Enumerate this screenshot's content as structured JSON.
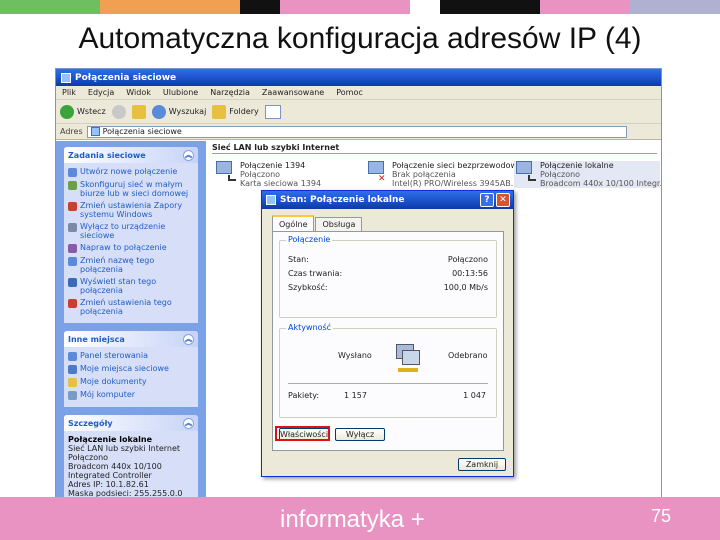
{
  "slide": {
    "title": "Automatyczna konfiguracja adresów IP (4)",
    "brand": "informatyka +",
    "page_number": "75",
    "colors": {
      "strip": [
        "#6fbf60",
        "#f0a050",
        "#111111",
        "#e893c2",
        "#f07a40",
        "#111111",
        "#e893c2",
        "#b0b0d0"
      ],
      "footer": "#e893c2"
    }
  },
  "window": {
    "title": "Połączenia sieciowe",
    "menu": [
      "Plik",
      "Edycja",
      "Widok",
      "Ulubione",
      "Narzędzia",
      "Zaawansowane",
      "Pomoc"
    ],
    "toolbar": {
      "back": "Wstecz",
      "search": "Wyszukaj",
      "folders": "Foldery"
    },
    "address_label": "Adres",
    "address_value": "Połączenia sieciowe"
  },
  "left_pane": {
    "network_tasks": {
      "title": "Zadania sieciowe",
      "items": [
        "Utwórz nowe połączenie",
        "Skonfiguruj sieć w małym biurze lub w sieci domowej",
        "Zmień ustawienia Zapory systemu Windows",
        "Wyłącz to urządzenie sieciowe",
        "Napraw to połączenie",
        "Zmień nazwę tego połączenia",
        "Wyświetl stan tego połączenia",
        "Zmień ustawienia tego połączenia"
      ]
    },
    "other_places": {
      "title": "Inne miejsca",
      "items": [
        "Panel sterowania",
        "Moje miejsca sieciowe",
        "Moje dokumenty",
        "Mój komputer"
      ]
    },
    "details": {
      "title": "Szczegóły",
      "name": "Połączenie lokalne",
      "lines": [
        "Sieć LAN lub szybki Internet",
        "Połączono",
        "Broadcom 440x 10/100 Integrated Controller",
        "Adres IP: 10.1.82.61",
        "Maska podsieci: 255.255.0.0"
      ]
    }
  },
  "group_header": "Sieć LAN lub szybki Internet",
  "connections": [
    {
      "name": "Połączenie 1394",
      "status": "Połączono",
      "device": "Karta sieciowa 1394"
    },
    {
      "name": "Połączenie sieci bezprzewodowej",
      "status": "Brak połączenia",
      "device": "Intel(R) PRO/Wireless 3945AB..."
    },
    {
      "name": "Połączenie lokalne",
      "status": "Połączono",
      "device": "Broadcom 440x 10/100 Integr..."
    }
  ],
  "dialog": {
    "title": "Stan: Połączenie lokalne",
    "tabs": [
      "Ogólne",
      "Obsługa"
    ],
    "connection_legend": "Połączenie",
    "rows": [
      {
        "label": "Stan:",
        "value": "Połączono"
      },
      {
        "label": "Czas trwania:",
        "value": "00:13:56"
      },
      {
        "label": "Szybkość:",
        "value": "100,0 Mb/s"
      }
    ],
    "activity_legend": "Aktywność",
    "sent_label": "Wysłano",
    "received_label": "Odebrano",
    "packets_label": "Pakiety:",
    "packets_sent": "1 157",
    "packets_received": "1 047",
    "properties_button": "Właściwości",
    "disable_button": "Wyłącz",
    "close_button": "Zamknij"
  }
}
